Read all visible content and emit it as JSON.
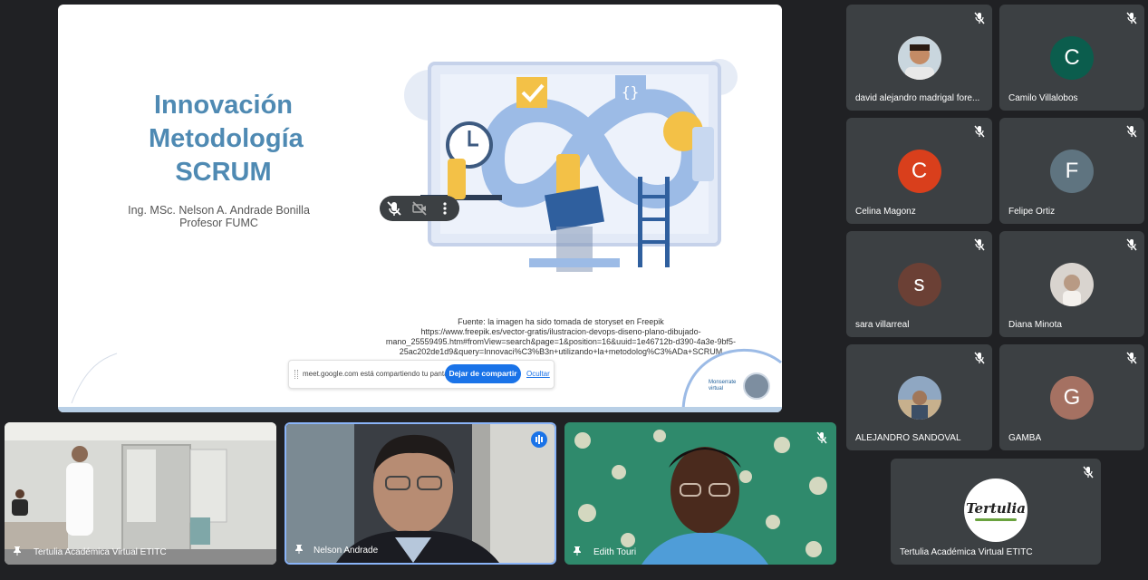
{
  "presentation": {
    "title_lines": [
      "Innovación",
      "Metodología",
      "SCRUM"
    ],
    "author_line1": "Ing. MSc. Nelson A. Andrade Bonilla",
    "author_line2": "Profesor FUMC",
    "source_line1": "Fuente: la imagen ha sido tomada de storyset en Freepik",
    "source_line2": "https://www.freepik.es/vector-gratis/ilustracion-devops-diseno-plano-dibujado-",
    "source_line3": "mano_25559495.htm#fromView=search&page=1&position=16&uuid=1e46712b-d390-4a3e-9bf5-",
    "source_line4": "25ac202de1d9&query=Innovaci%C3%B3n+utilizando+la+metodolog%C3%ADa+SCRUM",
    "logo_text": [
      "Monserrate",
      "virtual"
    ],
    "share_bar": {
      "text": "meet.google.com está compartiendo tu pantalla.",
      "stop_label": "Dejar de compartir",
      "hide_label": "Ocultar"
    }
  },
  "participants_grid": [
    {
      "name": "david alejandro madrigal fore...",
      "avatar_type": "photo"
    },
    {
      "name": "Camilo Villalobos",
      "initial": "C",
      "color": "#0b5d4d"
    },
    {
      "name": "Celina Magonz",
      "initial": "C",
      "color": "#d93f1c"
    },
    {
      "name": "Felipe Ortiz",
      "initial": "F",
      "color": "#5f7480"
    },
    {
      "name": "sara villarreal",
      "initial": "s",
      "color": "#6b4035"
    },
    {
      "name": "Diana Minota",
      "avatar_type": "photo"
    },
    {
      "name": "ALEJANDRO SANDOVAL",
      "avatar_type": "photo"
    },
    {
      "name": "GAMBA",
      "initial": "G",
      "color": "#a57162"
    },
    {
      "name": "Tertulia Académica Virtual ETITC",
      "logo_text": "Tertulia"
    }
  ],
  "video_tiles": [
    {
      "name": "Tertulia Académica Virtual ETITC"
    },
    {
      "name": "Nelson Andrade"
    },
    {
      "name": "Edith Touri"
    }
  ],
  "icons": {
    "mic_off": "mic-off-icon",
    "pin": "pin-icon",
    "speaking": "audio-level-icon",
    "more": "more-vert-icon"
  }
}
